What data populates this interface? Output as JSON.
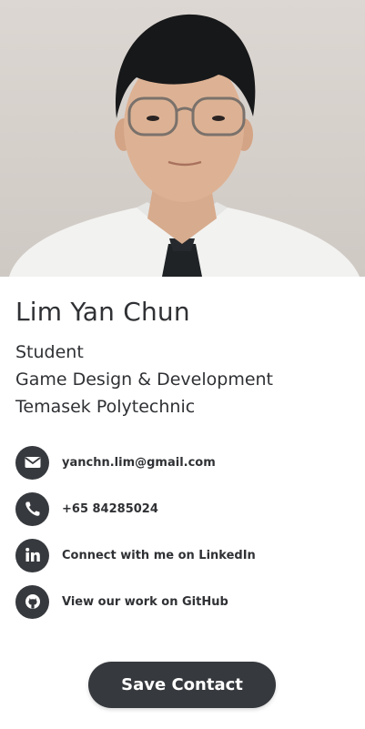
{
  "profile": {
    "photo_alt": "Profile photo",
    "name": "Lim Yan Chun",
    "lines": [
      "Student",
      "Game Design & Development",
      "Temasek Polytechnic"
    ]
  },
  "contacts": [
    {
      "icon": "envelope-icon",
      "label": "yanchn.lim@gmail.com"
    },
    {
      "icon": "phone-icon",
      "label": "+65 84285024"
    },
    {
      "icon": "linkedin-icon",
      "label": "Connect with me on LinkedIn"
    },
    {
      "icon": "github-icon",
      "label": "View our work on GitHub"
    }
  ],
  "actions": {
    "save_label": "Save Contact"
  },
  "colors": {
    "accent": "#36393d",
    "text": "#2f3134",
    "background": "#ffffff"
  }
}
